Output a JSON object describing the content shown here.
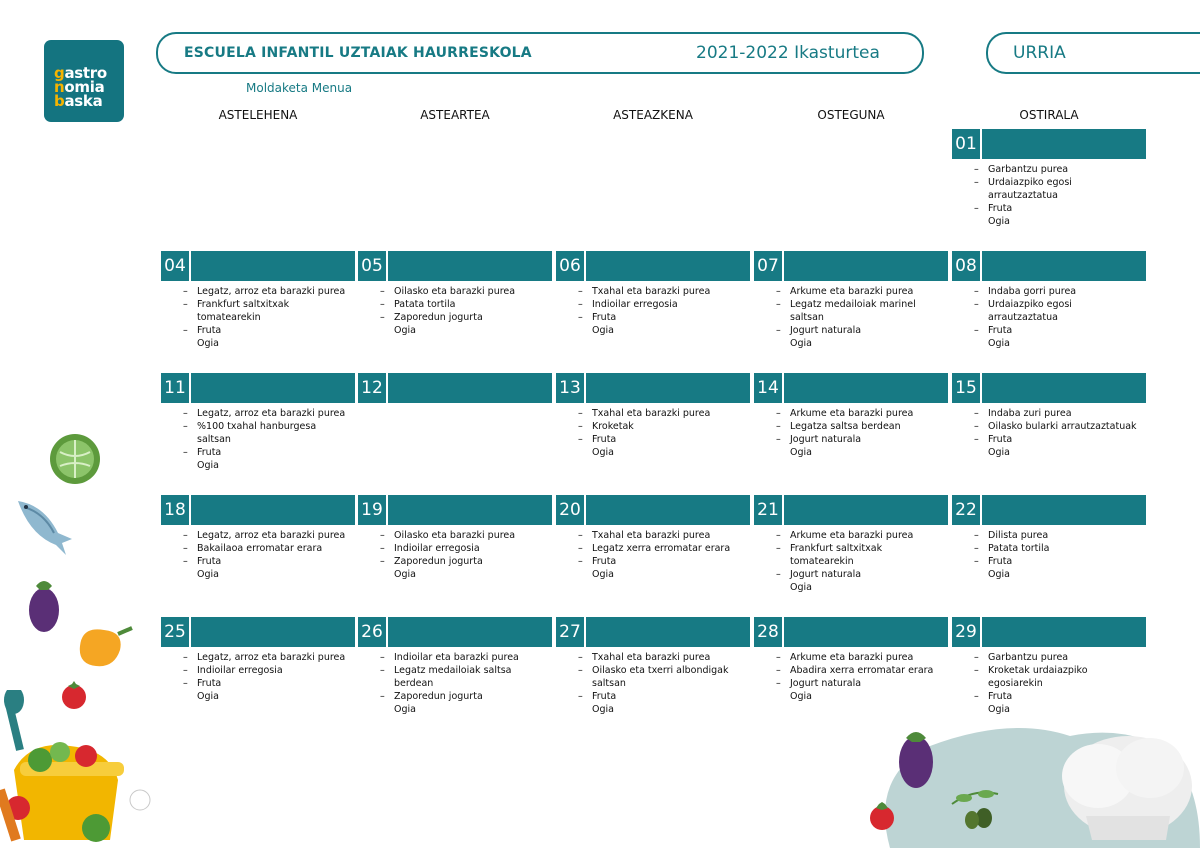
{
  "logo": {
    "lines": [
      [
        "g",
        "astro"
      ],
      [
        "n",
        "omia"
      ],
      [
        "b",
        "aska"
      ]
    ]
  },
  "header": {
    "school": "ESCUELA INFANTIL UZTAIAK HAURRESKOLA",
    "year": "2021-2022 Ikasturtea",
    "month": "URRIA",
    "subtitle": "Moldaketa Menua"
  },
  "weekdays": [
    "ASTELEHENA",
    "ASTEARTEA",
    "ASTEAZKENA",
    "OSTEGUNA",
    "OSTIRALA"
  ],
  "weeks": [
    [
      null,
      null,
      null,
      null,
      {
        "day": "01",
        "items": [
          {
            "dash": true,
            "text": "Garbantzu purea"
          },
          {
            "dash": true,
            "text": "Urdaiazpiko egosi"
          },
          {
            "dash": false,
            "text": "arrautzaztatua"
          },
          {
            "dash": true,
            "text": "Fruta"
          },
          {
            "dash": false,
            "text": "Ogia"
          }
        ]
      }
    ],
    [
      {
        "day": "04",
        "items": [
          {
            "dash": true,
            "text": "Legatz, arroz eta barazki purea"
          },
          {
            "dash": true,
            "text": "Frankfurt saltxitxak"
          },
          {
            "dash": false,
            "text": "tomatearekin"
          },
          {
            "dash": true,
            "text": "Fruta"
          },
          {
            "dash": false,
            "text": "Ogia"
          }
        ]
      },
      {
        "day": "05",
        "items": [
          {
            "dash": true,
            "text": "Oilasko eta barazki purea"
          },
          {
            "dash": true,
            "text": "Patata tortila"
          },
          {
            "dash": true,
            "text": "Zaporedun jogurta"
          },
          {
            "dash": false,
            "text": "Ogia"
          }
        ]
      },
      {
        "day": "06",
        "items": [
          {
            "dash": true,
            "text": "Txahal eta barazki purea"
          },
          {
            "dash": true,
            "text": "Indioilar erregosia"
          },
          {
            "dash": true,
            "text": "Fruta"
          },
          {
            "dash": false,
            "text": "Ogia"
          }
        ]
      },
      {
        "day": "07",
        "items": [
          {
            "dash": true,
            "text": "Arkume eta barazki purea"
          },
          {
            "dash": true,
            "text": "Legatz medailoiak marinel"
          },
          {
            "dash": false,
            "text": "saltsan"
          },
          {
            "dash": true,
            "text": "Jogurt naturala"
          },
          {
            "dash": false,
            "text": "Ogia"
          }
        ]
      },
      {
        "day": "08",
        "items": [
          {
            "dash": true,
            "text": "Indaba gorri purea"
          },
          {
            "dash": true,
            "text": "Urdaiazpiko egosi"
          },
          {
            "dash": false,
            "text": "arrautzaztatua"
          },
          {
            "dash": true,
            "text": "Fruta"
          },
          {
            "dash": false,
            "text": "Ogia"
          }
        ]
      }
    ],
    [
      {
        "day": "11",
        "items": [
          {
            "dash": true,
            "text": "Legatz, arroz eta barazki purea"
          },
          {
            "dash": true,
            "text": "%100 txahal hanburgesa"
          },
          {
            "dash": false,
            "text": "saltsan"
          },
          {
            "dash": true,
            "text": "Fruta"
          },
          {
            "dash": false,
            "text": "Ogia"
          }
        ]
      },
      {
        "day": "12",
        "items": []
      },
      {
        "day": "13",
        "items": [
          {
            "dash": true,
            "text": "Txahal eta barazki purea"
          },
          {
            "dash": true,
            "text": "Kroketak"
          },
          {
            "dash": true,
            "text": "Fruta"
          },
          {
            "dash": false,
            "text": "Ogia"
          }
        ]
      },
      {
        "day": "14",
        "items": [
          {
            "dash": true,
            "text": "Arkume eta barazki purea"
          },
          {
            "dash": true,
            "text": "Legatza saltsa berdean"
          },
          {
            "dash": true,
            "text": "Jogurt naturala"
          },
          {
            "dash": false,
            "text": "Ogia"
          }
        ]
      },
      {
        "day": "15",
        "items": [
          {
            "dash": true,
            "text": "Indaba zuri purea"
          },
          {
            "dash": true,
            "text": "Oilasko bularki arrautzaztatuak"
          },
          {
            "dash": true,
            "text": "Fruta"
          },
          {
            "dash": false,
            "text": "Ogia"
          }
        ]
      }
    ],
    [
      {
        "day": "18",
        "items": [
          {
            "dash": true,
            "text": "Legatz, arroz eta barazki purea"
          },
          {
            "dash": true,
            "text": "Bakailaoa erromatar erara"
          },
          {
            "dash": true,
            "text": "Fruta"
          },
          {
            "dash": false,
            "text": "Ogia"
          }
        ]
      },
      {
        "day": "19",
        "items": [
          {
            "dash": true,
            "text": "Oilasko eta barazki purea"
          },
          {
            "dash": true,
            "text": "Indioilar erregosia"
          },
          {
            "dash": true,
            "text": "Zaporedun jogurta"
          },
          {
            "dash": false,
            "text": "Ogia"
          }
        ]
      },
      {
        "day": "20",
        "items": [
          {
            "dash": true,
            "text": "Txahal eta barazki purea"
          },
          {
            "dash": true,
            "text": "Legatz xerra erromatar erara"
          },
          {
            "dash": true,
            "text": "Fruta"
          },
          {
            "dash": false,
            "text": "Ogia"
          }
        ]
      },
      {
        "day": "21",
        "items": [
          {
            "dash": true,
            "text": "Arkume eta barazki purea"
          },
          {
            "dash": true,
            "text": "Frankfurt saltxitxak"
          },
          {
            "dash": false,
            "text": "tomatearekin"
          },
          {
            "dash": true,
            "text": "Jogurt naturala"
          },
          {
            "dash": false,
            "text": "Ogia"
          }
        ]
      },
      {
        "day": "22",
        "items": [
          {
            "dash": true,
            "text": "Dilista purea"
          },
          {
            "dash": true,
            "text": "Patata tortila"
          },
          {
            "dash": true,
            "text": "Fruta"
          },
          {
            "dash": false,
            "text": "Ogia"
          }
        ]
      }
    ],
    [
      {
        "day": "25",
        "items": [
          {
            "dash": true,
            "text": "Legatz, arroz eta barazki purea"
          },
          {
            "dash": true,
            "text": "Indioilar erregosia"
          },
          {
            "dash": true,
            "text": "Fruta"
          },
          {
            "dash": false,
            "text": "Ogia"
          }
        ]
      },
      {
        "day": "26",
        "items": [
          {
            "dash": true,
            "text": "Indioilar eta barazki purea"
          },
          {
            "dash": true,
            "text": "Legatz medailoiak saltsa"
          },
          {
            "dash": false,
            "text": "berdean"
          },
          {
            "dash": true,
            "text": "Zaporedun jogurta"
          },
          {
            "dash": false,
            "text": "Ogia"
          }
        ]
      },
      {
        "day": "27",
        "items": [
          {
            "dash": true,
            "text": "Txahal eta barazki purea"
          },
          {
            "dash": true,
            "text": "Oilasko eta txerri albondigak"
          },
          {
            "dash": false,
            "text": "saltsan"
          },
          {
            "dash": true,
            "text": "Fruta"
          },
          {
            "dash": false,
            "text": "Ogia"
          }
        ]
      },
      {
        "day": "28",
        "items": [
          {
            "dash": true,
            "text": "Arkume eta barazki purea"
          },
          {
            "dash": true,
            "text": "Abadira xerra erromatar erara"
          },
          {
            "dash": true,
            "text": "Jogurt naturala"
          },
          {
            "dash": false,
            "text": "Ogia"
          }
        ]
      },
      {
        "day": "29",
        "items": [
          {
            "dash": true,
            "text": "Garbantzu purea"
          },
          {
            "dash": true,
            "text": "Kroketak urdaiazpiko"
          },
          {
            "dash": false,
            "text": "egosiarekin"
          },
          {
            "dash": true,
            "text": "Fruta"
          },
          {
            "dash": false,
            "text": "Ogia"
          }
        ]
      }
    ]
  ],
  "dash_symbol": "–",
  "colors": {
    "accent": "#177a84",
    "logo_bg": "#147480",
    "logo_highlight": "#f5b400"
  },
  "decorations": [
    "cabbage-icon",
    "fish-icon",
    "eggplant-icon",
    "pepper-icon",
    "tomato-icon",
    "cooking-pot-icon",
    "chef-hat-icon",
    "olive-icon"
  ]
}
